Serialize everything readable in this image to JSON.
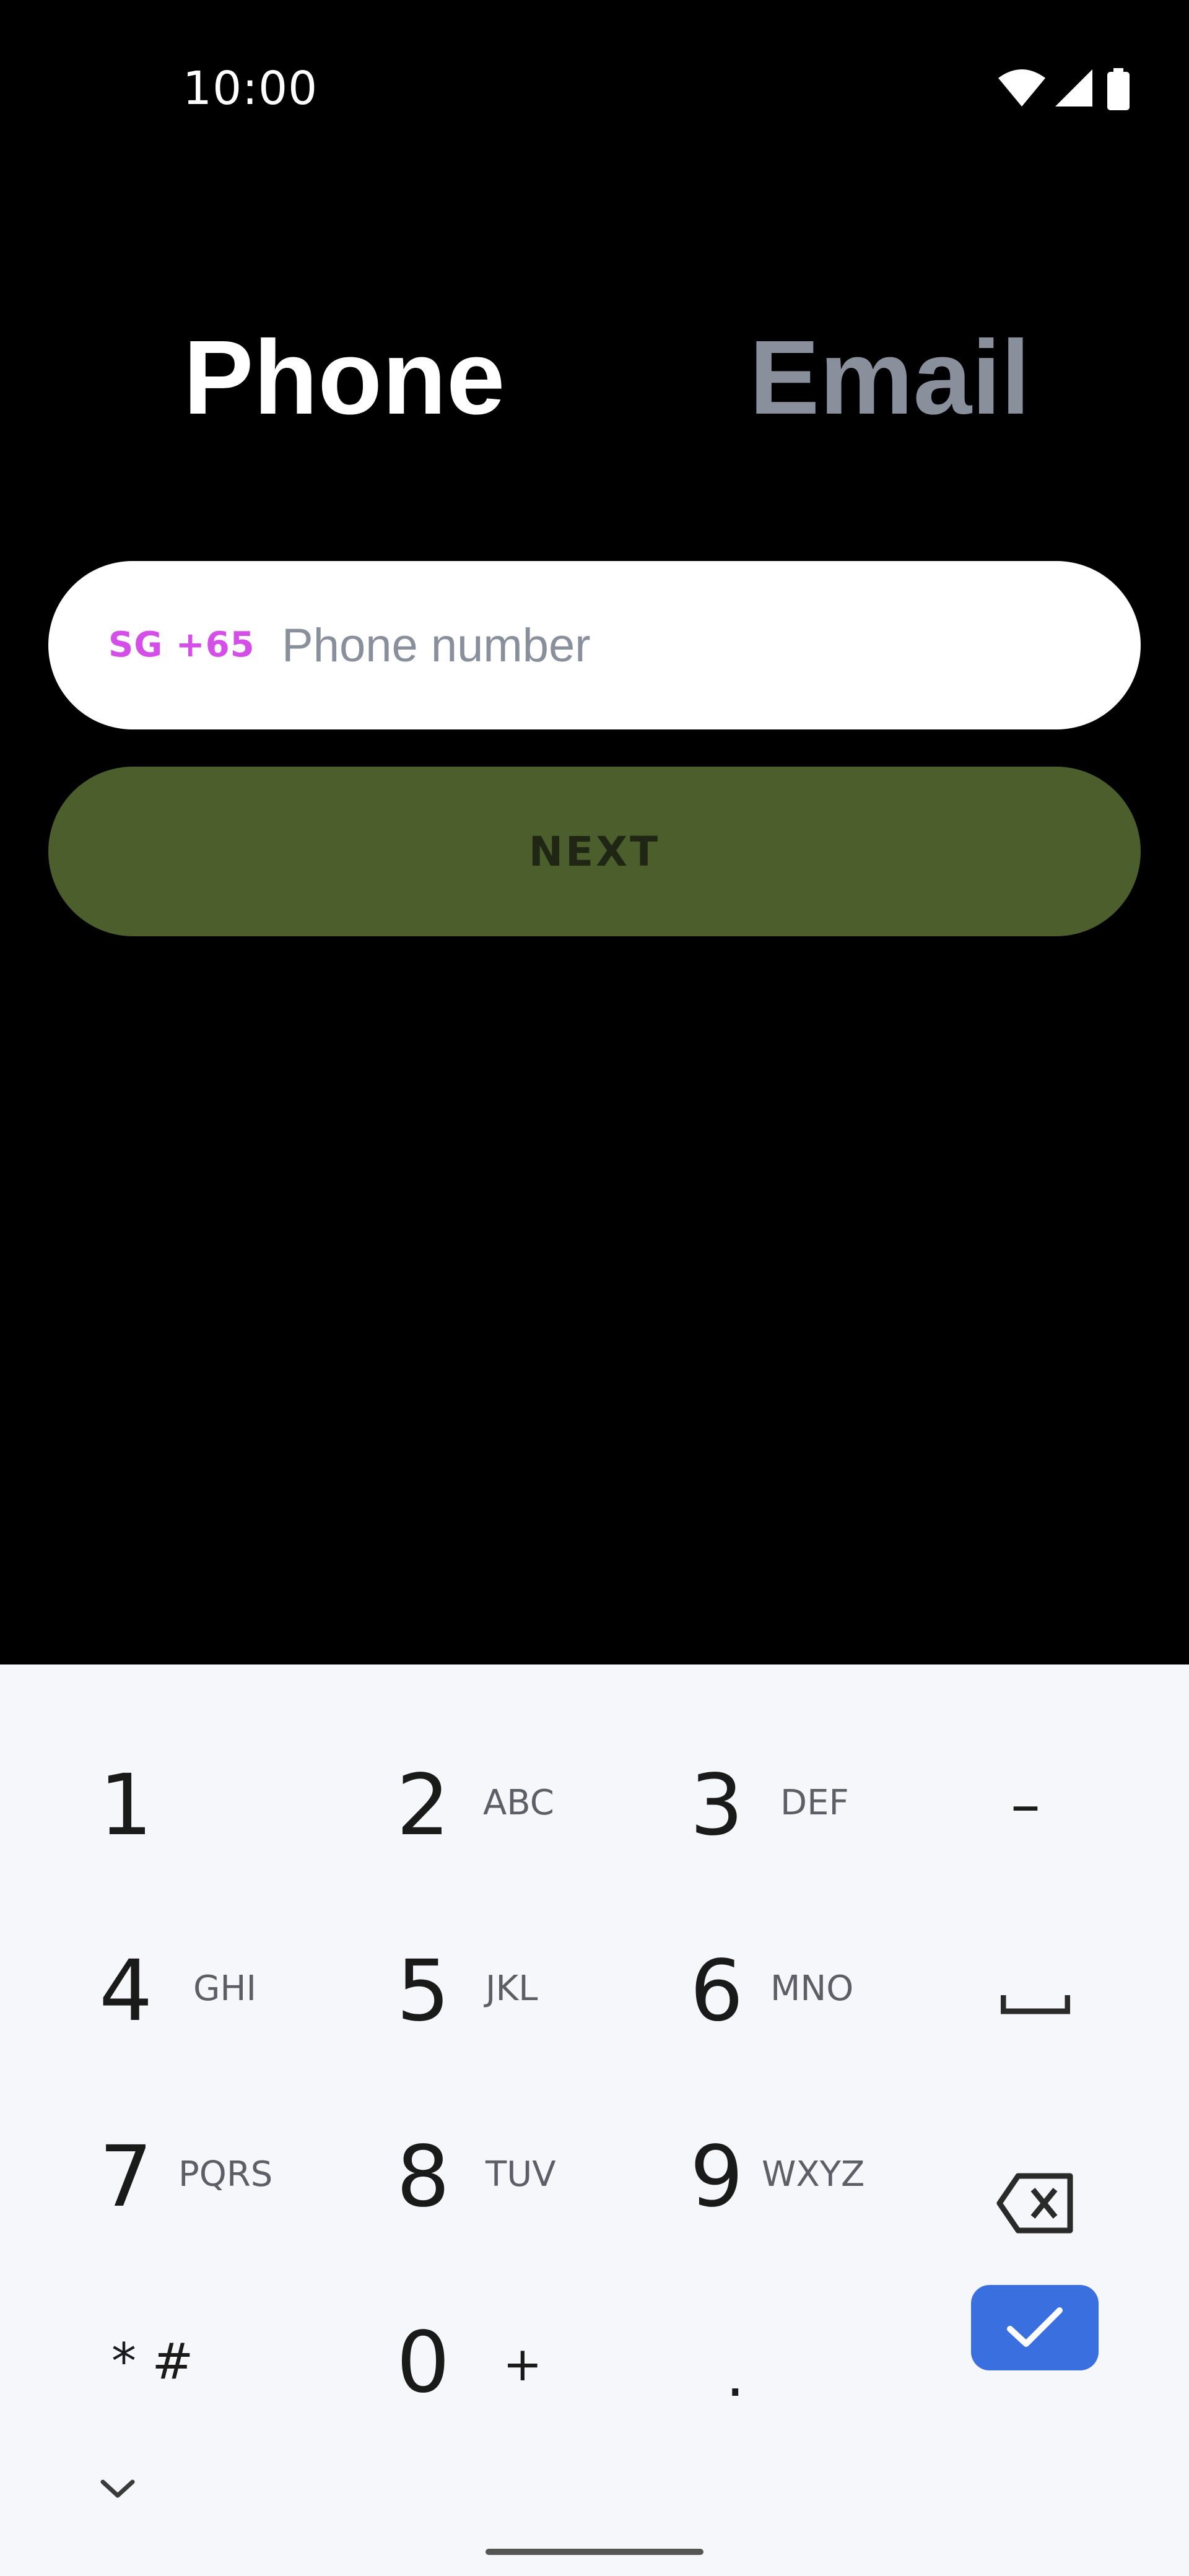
{
  "status_bar": {
    "time": "10:00",
    "icons": [
      "wifi-icon",
      "signal-icon",
      "battery-icon"
    ]
  },
  "tabs": {
    "phone_label": "Phone",
    "email_label": "Email",
    "active": "Phone"
  },
  "phone_field": {
    "country_code": "SG +65",
    "value": "",
    "placeholder": "Phone number"
  },
  "next_button": {
    "label": "NEXT"
  },
  "keyboard": {
    "keys": [
      {
        "digit": "1",
        "letters": ""
      },
      {
        "digit": "2",
        "letters": "ABC"
      },
      {
        "digit": "3",
        "letters": "DEF"
      },
      {
        "digit": "4",
        "letters": "GHI"
      },
      {
        "digit": "5",
        "letters": "JKL"
      },
      {
        "digit": "6",
        "letters": "MNO"
      },
      {
        "digit": "7",
        "letters": "PQRS"
      },
      {
        "digit": "8",
        "letters": "TUV"
      },
      {
        "digit": "9",
        "letters": "WXYZ"
      },
      {
        "digit": "0",
        "letters": "+"
      }
    ],
    "star_hash": "* #",
    "dash": "–",
    "period": ".",
    "function_icons": [
      "space-icon",
      "backspace-icon",
      "checkmark-icon",
      "chevron-down-icon"
    ]
  },
  "colors": {
    "background": "#000000",
    "country_code": "#d44ee8",
    "next_button": "#4c5e2b",
    "inactive_tab": "#8a8f9c",
    "done_key": "#3a6fe0",
    "keyboard_bg": "#f6f7fa"
  }
}
